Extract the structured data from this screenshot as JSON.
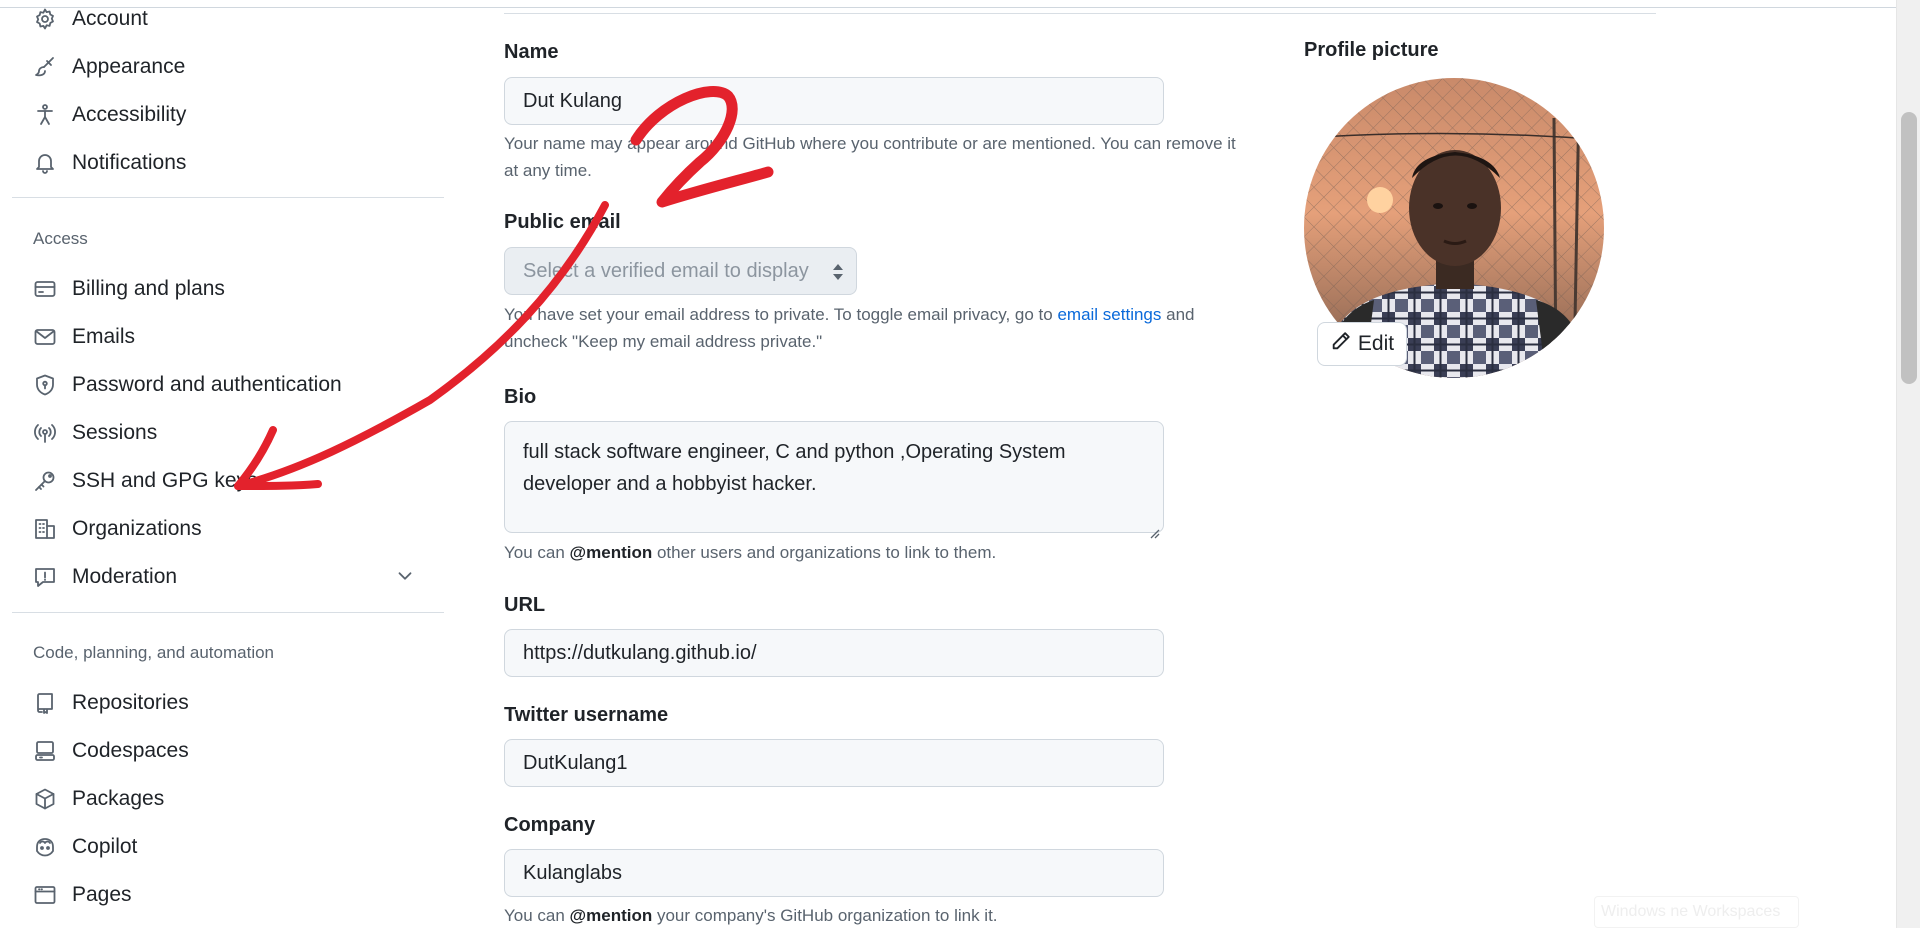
{
  "sidebar": {
    "top_items": [
      {
        "label": "Account",
        "icon": "gear-icon"
      },
      {
        "label": "Appearance",
        "icon": "paintbrush-icon"
      },
      {
        "label": "Accessibility",
        "icon": "accessibility-icon"
      },
      {
        "label": "Notifications",
        "icon": "bell-icon"
      }
    ],
    "access_title": "Access",
    "access_items": [
      {
        "label": "Billing and plans",
        "icon": "credit-card-icon"
      },
      {
        "label": "Emails",
        "icon": "mail-icon"
      },
      {
        "label": "Password and authentication",
        "icon": "shield-lock-icon"
      },
      {
        "label": "Sessions",
        "icon": "broadcast-icon"
      },
      {
        "label": "SSH and GPG keys",
        "icon": "key-icon"
      },
      {
        "label": "Organizations",
        "icon": "organization-icon"
      },
      {
        "label": "Moderation",
        "icon": "report-icon"
      }
    ],
    "code_title": "Code, planning, and automation",
    "code_items": [
      {
        "label": "Repositories",
        "icon": "repo-icon"
      },
      {
        "label": "Codespaces",
        "icon": "codespaces-icon"
      },
      {
        "label": "Packages",
        "icon": "package-icon"
      },
      {
        "label": "Copilot",
        "icon": "copilot-icon"
      },
      {
        "label": "Pages",
        "icon": "browser-icon"
      }
    ]
  },
  "form": {
    "name_label": "Name",
    "name_value": "Dut Kulang",
    "name_hint": "Your name may appear around GitHub where you contribute or are mentioned. You can remove it at any time.",
    "email_label": "Public email",
    "email_placeholder": "Select a verified email to display",
    "email_hint_pre": "You have set your email address to private. To toggle email privacy, go to ",
    "email_hint_link": "email settings",
    "email_hint_post": " and uncheck \"Keep my email address private.\"",
    "bio_label": "Bio",
    "bio_value": "full stack software engineer, C and python ,Operating System developer and a hobbyist hacker.",
    "bio_hint_pre": "You can ",
    "bio_hint_bold": "@mention",
    "bio_hint_post": " other users and organizations to link to them.",
    "url_label": "URL",
    "url_value": "https://dutkulang.github.io/",
    "twitter_label": "Twitter username",
    "twitter_value": "DutKulang1",
    "company_label": "Company",
    "company_value": "Kulanglabs",
    "company_hint_pre": "You can ",
    "company_hint_bold": "@mention",
    "company_hint_post": " your company's GitHub organization to link it."
  },
  "profile": {
    "title": "Profile picture",
    "edit_label": "Edit"
  },
  "annotation": {
    "number": "2",
    "color": "#e3222c"
  },
  "watermark": "Windows ne Workspaces",
  "colors": {
    "link": "#0969da",
    "muted": "#59636e",
    "field_bg": "#f6f8fa",
    "border": "#d0d7de"
  }
}
